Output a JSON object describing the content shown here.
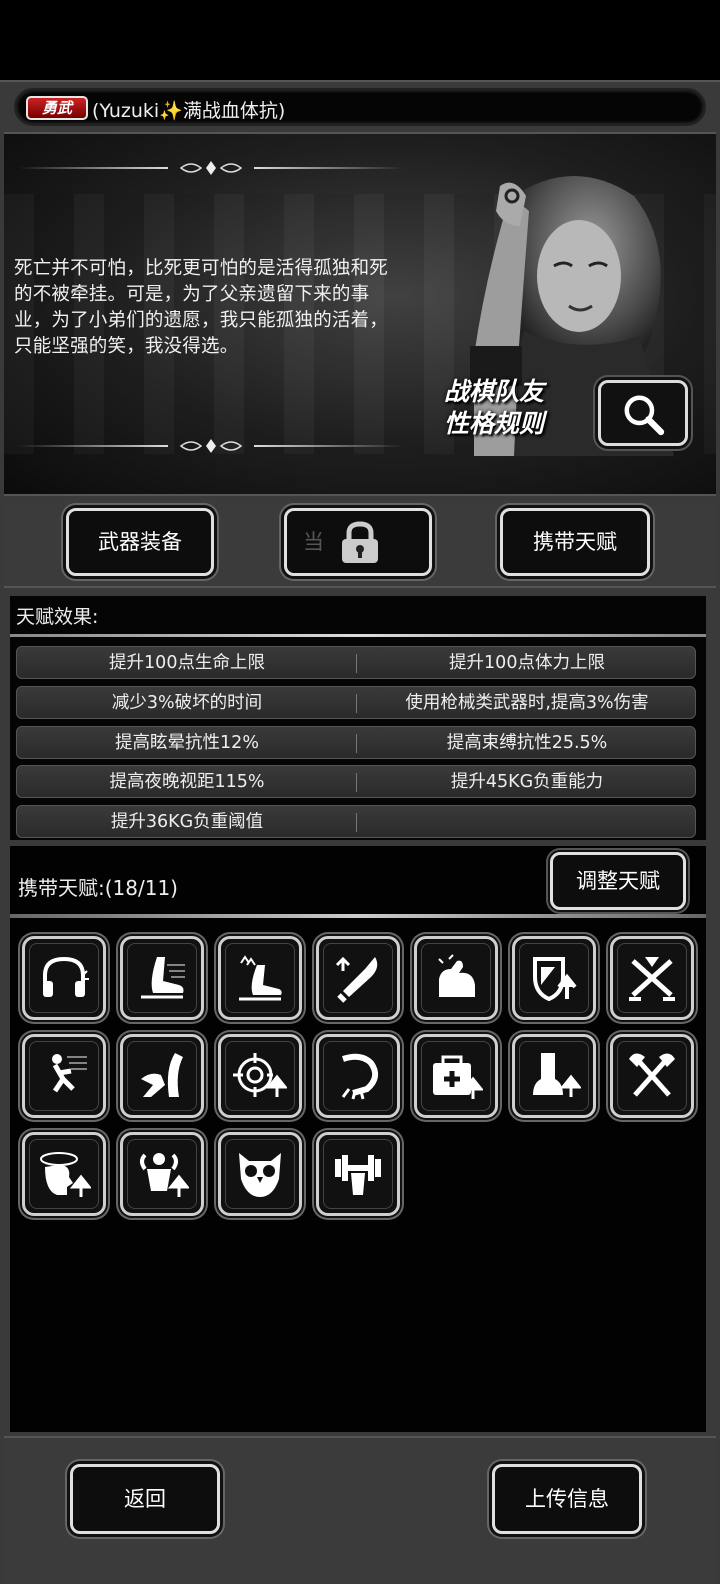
{
  "header": {
    "badge": "勇武",
    "title": "(Yuzuki✨满战血体抗)"
  },
  "story": {
    "text": "死亡并不可怕，比死更可怕的是活得孤独和死的不被牵挂。可是，为了父亲遗留下来的事业，为了小弟们的遗愿，我只能孤独的活着，只能坚强的笑，我没得选。",
    "rules_label_line1": "战棋队友",
    "rules_label_line2": "性格规则"
  },
  "buttons": {
    "weapon": "武器装备",
    "locked": "当",
    "carry": "携带天赋"
  },
  "effects": {
    "title": "天赋效果:",
    "rows": [
      [
        "提升100点生命上限",
        "提升100点体力上限"
      ],
      [
        "减少3%破坏的时间",
        "使用枪械类武器时,提高3%伤害"
      ],
      [
        "提高眩晕抗性12%",
        "提高束缚抗性25.5%"
      ],
      [
        "提高夜晚视距115%",
        "提升45KG负重能力"
      ],
      [
        "提升36KG负重阈值",
        ""
      ]
    ]
  },
  "carry": {
    "title": "携带天赋:(18/11)",
    "adjust": "调整天赋",
    "icons": [
      "headphones-icon",
      "foot-speed-icon",
      "foot-speed-up-icon",
      "blade-up-icon",
      "strength-arm-icon",
      "shield-up-icon",
      "crossed-swords-icon",
      "runner-icon",
      "dodge-icon",
      "target-up-icon",
      "grab-claw-icon",
      "medkit-up-icon",
      "boot-up-icon",
      "crossed-axes-icon",
      "head-stun-up-icon",
      "muscle-up-icon",
      "owl-icon",
      "dumbbell-icon"
    ]
  },
  "bottom": {
    "back": "返回",
    "upload": "上传信息"
  }
}
